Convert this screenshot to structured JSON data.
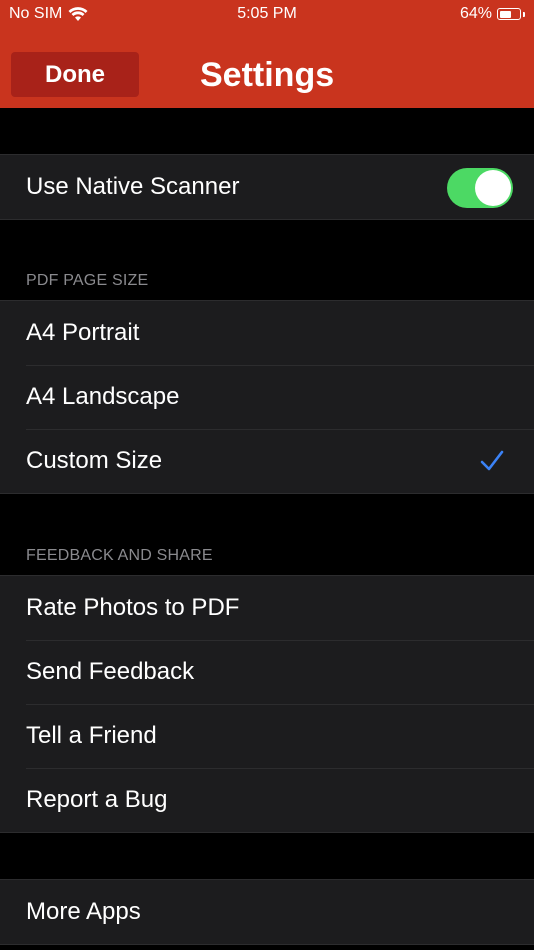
{
  "status_bar": {
    "carrier": "No SIM",
    "time": "5:05 PM",
    "battery_percent": "64%",
    "battery_level": 0.64,
    "wifi_icon": "wifi-icon",
    "battery_icon": "battery-icon"
  },
  "nav": {
    "done_label": "Done",
    "title": "Settings"
  },
  "scanner_section": {
    "label": "Use Native Scanner",
    "toggle_on": true
  },
  "page_size_section": {
    "header": "PDF PAGE SIZE",
    "options": [
      {
        "label": "A4 Portrait",
        "selected": false
      },
      {
        "label": "A4 Landscape",
        "selected": false
      },
      {
        "label": "Custom Size",
        "selected": true
      }
    ]
  },
  "feedback_section": {
    "header": "FEEDBACK AND SHARE",
    "items": [
      {
        "label": "Rate Photos to PDF"
      },
      {
        "label": "Send Feedback"
      },
      {
        "label": "Tell a Friend"
      },
      {
        "label": "Report a Bug"
      }
    ]
  },
  "more_section": {
    "items": [
      {
        "label": "More Apps"
      }
    ]
  },
  "colors": {
    "header_bg": "#c9341e",
    "done_bg": "#a82219",
    "toggle_on": "#4cd964",
    "checkmark": "#3b82f6",
    "cell_bg": "#1c1c1e",
    "section_header_text": "#8a8a8e"
  }
}
